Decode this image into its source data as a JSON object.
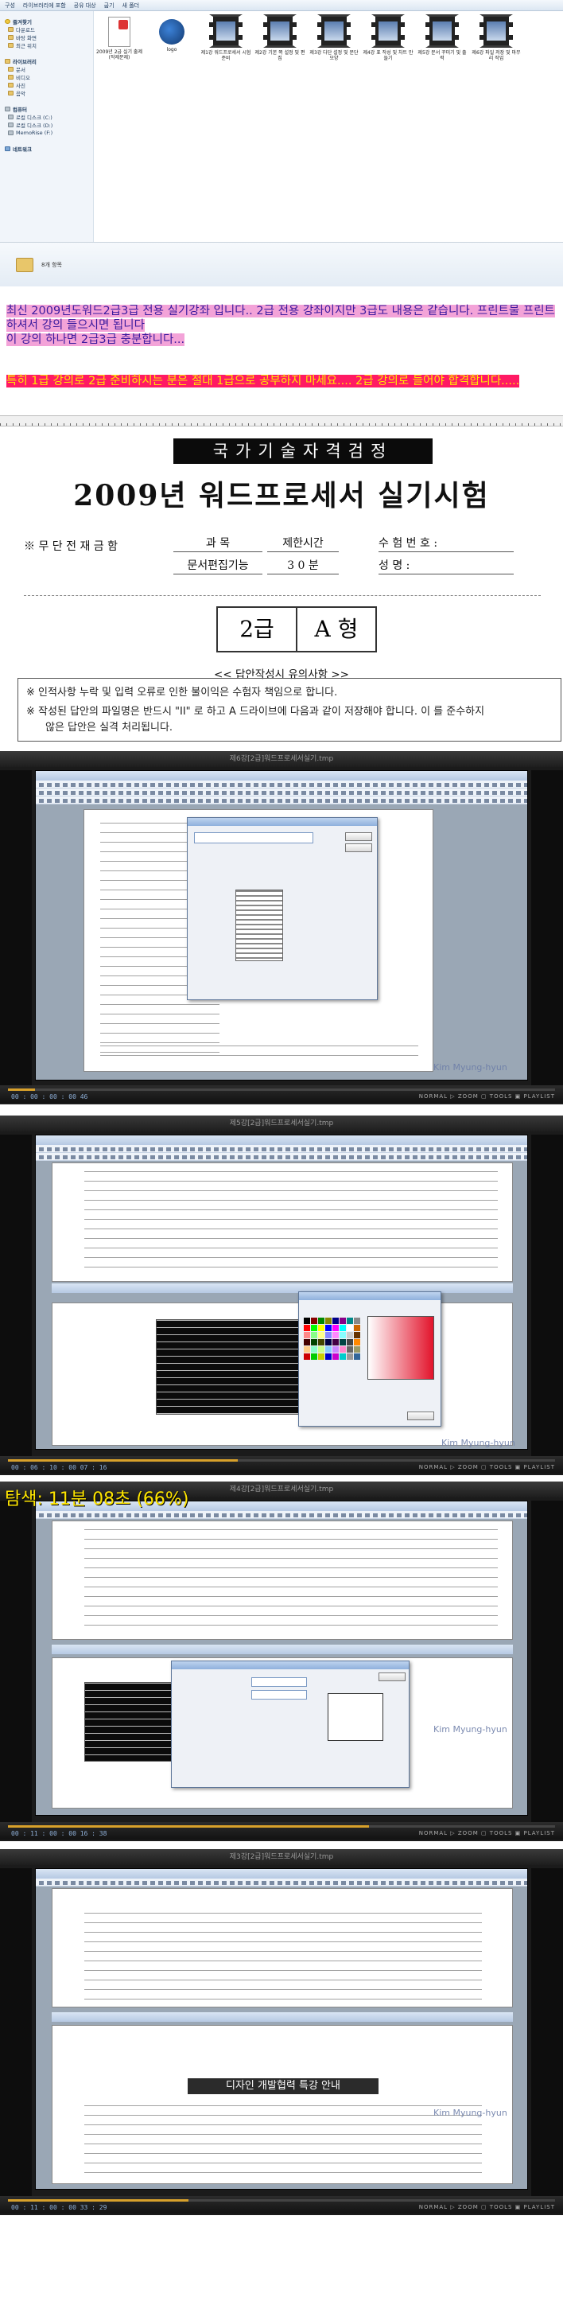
{
  "explorer": {
    "toolbar": [
      "구성",
      "라이브러리에 포함",
      "공유 대상",
      "굽기",
      "새 폴더"
    ],
    "nav": {
      "favorites_head": "즐겨찾기",
      "favorites": [
        "다운로드",
        "바탕 화면",
        "최근 위치"
      ],
      "libraries_head": "라이브러리",
      "libraries": [
        "문서",
        "비디오",
        "사진",
        "음악"
      ],
      "computer_head": "컴퓨터",
      "drives": [
        "로컬 디스크 (C:)",
        "로컬 디스크 (D:)",
        "MemoRise (F:)"
      ],
      "network_head": "네트워크"
    },
    "files": [
      {
        "name": "2009년 2급 실기 출제 (작제문제)",
        "kind": "doc"
      },
      {
        "name": "logo",
        "kind": "logo"
      },
      {
        "name": "제1강 워드프로세서 시험 준비",
        "kind": "video"
      },
      {
        "name": "제2강 기본 쪽 설정 및 편집",
        "kind": "video"
      },
      {
        "name": "제3강 다단 설정 및 문단 모양",
        "kind": "video"
      },
      {
        "name": "제4강 표 작성 및 차트 만들기",
        "kind": "video"
      },
      {
        "name": "제5강 문서 꾸미기 및 출력",
        "kind": "video"
      },
      {
        "name": "제6강 파일 저장 및 마무리 작업",
        "kind": "video"
      }
    ],
    "status": "8개 항목"
  },
  "notice": {
    "line1": "최신 2009년도워드2급3급 전용 실기강좌 입니다.. 2급 전용 강좌이지만 3급도 내용은 같습니다.    프린트물 프린트하셔서 강의 들으시면 됩니다",
    "line2": "이 강의 하나면 2급3급 충분합니다...",
    "warning": "특히 1급 강의로 2급 준비하시는 분은 절대 1급으로 공부하지 마세요.... 2급 강의로 들어야  합격합니다....."
  },
  "exam": {
    "banner": "국가기술자격검정",
    "title": "2009년 워드프로세서 실기시험",
    "row1_mark": "※ 무 단 전 재 금 함",
    "col_subject": "과        목",
    "col_time": "제한시간",
    "col_examno": "수 험 번 호 :",
    "subject_value": "문서편집기능",
    "time_value": "3 0 분",
    "col_name": "성        명 :",
    "grade": "2급",
    "type": "A 형",
    "answer_heading": "<< 답안작성시 유의사항 >>",
    "warnings": [
      "※ 인적사항 누락 및 입력 오류로 인한 불이익은 수험자 책임으로 합니다.",
      "※ 작성된 답안의 파일명은 반드시 \"II\" 로 하고 A 드라이브에 다음과 같이 저장해야 합니다. 이 를 준수하지",
      "않은 답안은 실격 처리됩니다."
    ]
  },
  "players": [
    {
      "title": "제6강[2급]워드프로세서실기.tmp",
      "time": "00 : 00 : 00 : 00 46",
      "progress": 0.05,
      "watermark": "Kim Myung-hyun",
      "controls": "NORMAL ▷ ZOOM ▢ TOOLS ▣ PLAYLIST"
    },
    {
      "title": "제5강[2급]워드프로세서실기.tmp",
      "time": "00 : 06 : 10 : 00 07 : 16",
      "progress": 0.42,
      "watermark": "Kim Myung-hyun",
      "controls": "NORMAL ▷ ZOOM ▢ TOOLS ▣ PLAYLIST"
    },
    {
      "title": "제4강[2급]워드프로세서실기.tmp",
      "timer": "탐색: 11분 08초 (66%)",
      "time": "00 : 11 : 00 : 00 16 : 38",
      "progress": 0.66,
      "watermark": "Kim Myung-hyun",
      "controls": "NORMAL ▷ ZOOM ▢ TOOLS ▣ PLAYLIST"
    },
    {
      "title": "제3강[2급]워드프로세서실기.tmp",
      "time": "00 : 11 : 00 : 00 33 : 29",
      "progress": 0.33,
      "watermark": "Kim Myung-hyun",
      "heading": "디자인 개발협력 특강 안내",
      "controls": "NORMAL ▷ ZOOM ▢ TOOLS ▣ PLAYLIST"
    }
  ],
  "colors": {
    "pink_highlight": "#f3a3d8",
    "red_highlight": "#ff1a63",
    "yellow_text": "#ffe600",
    "player_bg": "#1b1b1b",
    "progress": "#d8a12b"
  }
}
